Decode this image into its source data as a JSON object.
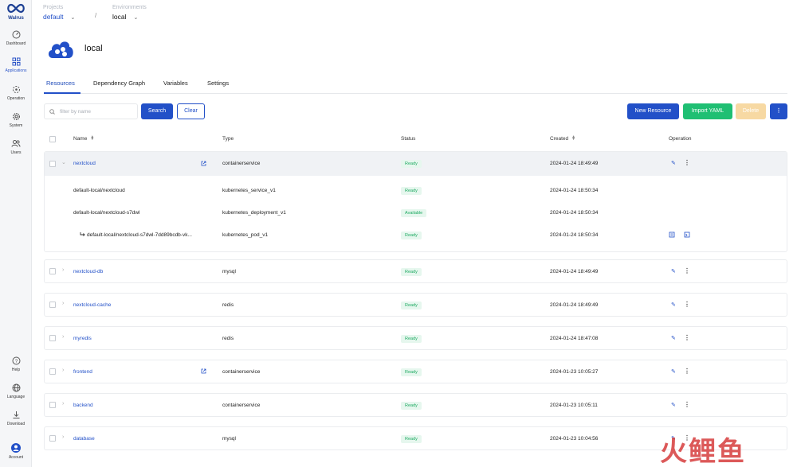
{
  "brand": {
    "name": "Walrus"
  },
  "sidebar": {
    "items": [
      {
        "label": "Dashboard"
      },
      {
        "label": "Applications"
      },
      {
        "label": "Operation"
      },
      {
        "label": "System"
      },
      {
        "label": "Users"
      }
    ],
    "bottom": [
      {
        "label": "Help"
      },
      {
        "label": "Language"
      },
      {
        "label": "Download"
      },
      {
        "label": "Account"
      }
    ]
  },
  "header": {
    "project_label": "Projects",
    "project_value": "default",
    "separator": "/",
    "env_label": "Environments",
    "env_value": "local"
  },
  "page": {
    "title": "local"
  },
  "tabs": [
    {
      "label": "Resources"
    },
    {
      "label": "Dependency Graph"
    },
    {
      "label": "Variables"
    },
    {
      "label": "Settings"
    }
  ],
  "toolbar": {
    "search_placeholder": "filter by name",
    "search_label": "Search",
    "clear_label": "Clear",
    "new_resource_label": "New Resource",
    "import_yaml_label": "Import YAML",
    "delete_label": "Delete",
    "more_label": "⋮"
  },
  "table": {
    "headers": {
      "name": "Name",
      "type": "Type",
      "status": "Status",
      "created": "Created",
      "operation": "Operation"
    },
    "rows": [
      {
        "name": "nextcloud",
        "type": "containerservice",
        "status": "Ready",
        "created": "2024-01-24 18:49:49",
        "children": [
          {
            "name": "default-local/nextcloud",
            "type": "kubernetes_service_v1",
            "status": "Ready",
            "created": "2024-01-24 18:50:34"
          },
          {
            "name": "default-local/nextcloud-s7dwl",
            "type": "kubernetes_deployment_v1",
            "status": "Available",
            "created": "2024-01-24 18:50:34"
          },
          {
            "name": "default-local/nextcloud-s7dwl-7dd89bcdb-vk...",
            "type": "kubernetes_pod_v1",
            "status": "Ready",
            "created": "2024-01-24 18:50:34"
          }
        ]
      },
      {
        "name": "nextcloud-db",
        "type": "mysql",
        "status": "Ready",
        "created": "2024-01-24 18:49:49"
      },
      {
        "name": "nextcloud-cache",
        "type": "redis",
        "status": "Ready",
        "created": "2024-01-24 18:49:49"
      },
      {
        "name": "myredis",
        "type": "redis",
        "status": "Ready",
        "created": "2024-01-24 18:47:08"
      },
      {
        "name": "frontend",
        "type": "containerservice",
        "status": "Ready",
        "created": "2024-01-23 10:05:27"
      },
      {
        "name": "backend",
        "type": "containerservice",
        "status": "Ready",
        "created": "2024-01-23 10:05:11"
      },
      {
        "name": "database",
        "type": "mysql",
        "status": "Ready",
        "created": "2024-01-23 10:04:56"
      }
    ]
  },
  "watermark": "火鲤鱼",
  "colors": {
    "primary": "#2250c8",
    "success": "#1fbf73",
    "warning_disabled": "#f7d9a3"
  }
}
